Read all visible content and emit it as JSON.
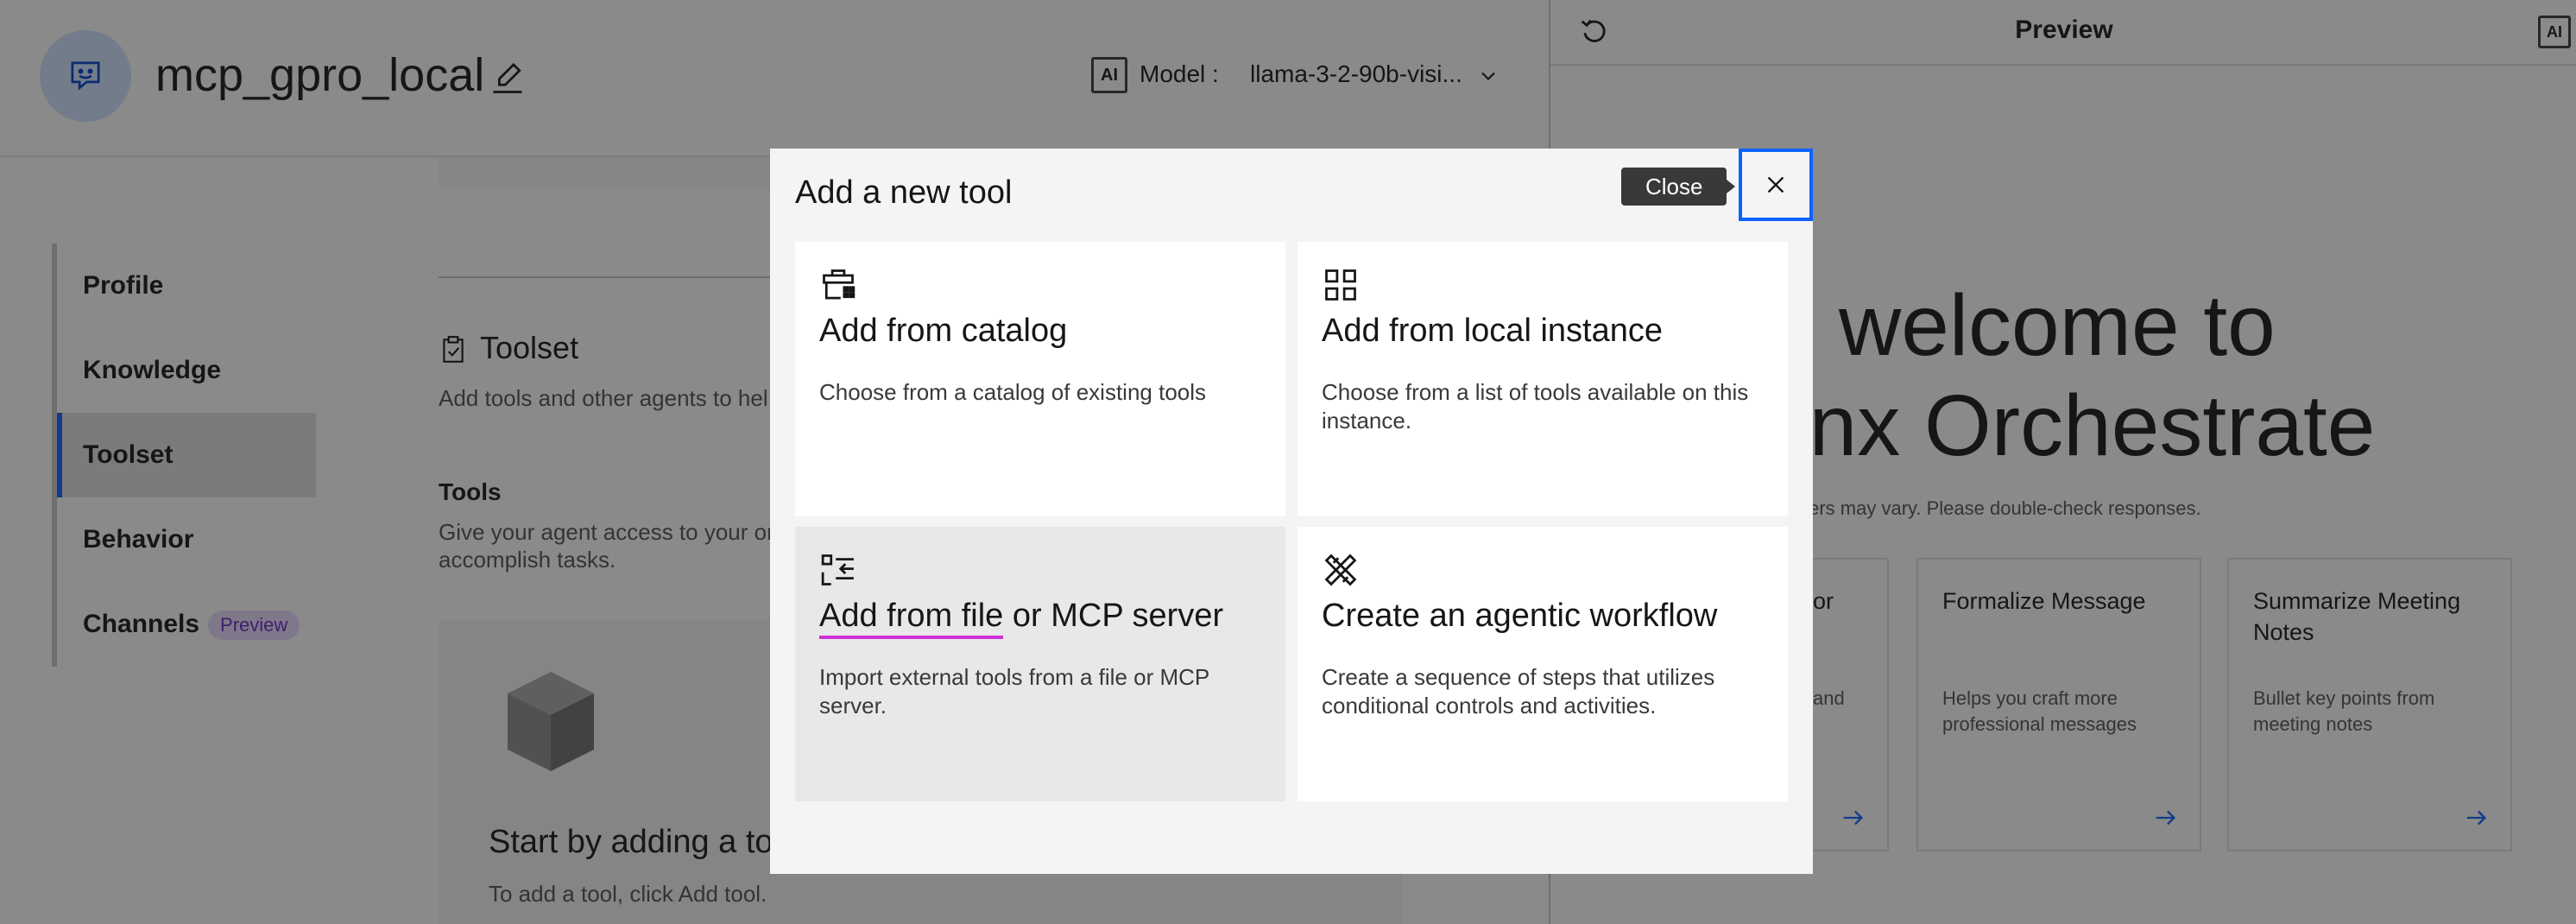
{
  "header": {
    "agent_name": "mcp_gpro_local",
    "ai_badge": "AI",
    "model_label": "Model :",
    "model_value": "llama-3-2-90b-visi..."
  },
  "nav": {
    "items": [
      {
        "label": "Profile"
      },
      {
        "label": "Knowledge"
      },
      {
        "label": "Toolset"
      },
      {
        "label": "Behavior"
      },
      {
        "label": "Channels",
        "tag": "Preview"
      }
    ],
    "active": "Toolset"
  },
  "content": {
    "toolset_title": "Toolset",
    "toolset_desc": "Add tools and other agents to hel",
    "tools_title": "Tools",
    "tools_desc": "Give your agent access to your or accomplish tasks.",
    "empty_title": "Start by adding a tool",
    "empty_desc": "To add a tool, click Add tool."
  },
  "preview": {
    "title": "Preview",
    "ai_badge": "AI",
    "welcome_line1": "welcome to",
    "welcome_line2": "onx Orchestrate",
    "disclaimer": "nswers may vary. Please double-check responses.",
    "cards": [
      {
        "title": "or",
        "desc": "and"
      },
      {
        "title": "Formalize Message",
        "desc": "Helps you craft more professional messages"
      },
      {
        "title": "Summarize Meeting Notes",
        "desc": "Bullet key points from meeting notes"
      }
    ]
  },
  "modal": {
    "title": "Add a new tool",
    "close_tooltip": "Close",
    "tiles": [
      {
        "title": "Add from catalog",
        "desc": "Choose from a catalog of existing tools",
        "icon": "toolbox-icon"
      },
      {
        "title": "Add from local instance",
        "desc": "Choose from a list of tools available on this instance.",
        "icon": "grid-icon"
      },
      {
        "title_part1": "Add from file",
        "title_part2": " or MCP server",
        "desc": "Import external tools from a file or MCP server.",
        "icon": "import-list-icon"
      },
      {
        "title": "Create an agentic workflow",
        "desc": "Create a sequence of steps that utilizes conditional controls and activities.",
        "icon": "tools-icon"
      }
    ]
  },
  "colors": {
    "accent": "#0f62fe",
    "highlight_underline": "#d12fd7",
    "overlay": "rgba(22,22,22,0.5)",
    "tag_purple": "#6929c4"
  }
}
